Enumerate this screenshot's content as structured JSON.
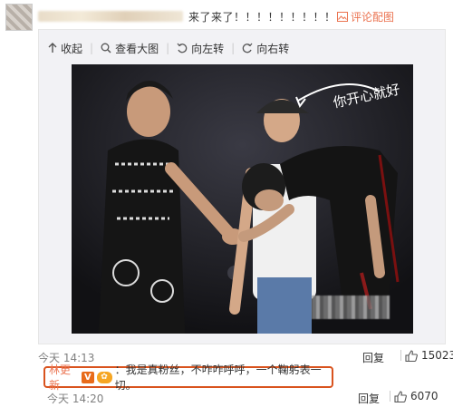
{
  "comment": {
    "text": "来了来了！！！！！！！！！",
    "config_label": "评论配图"
  },
  "toolbar": {
    "collapse_label": "收起",
    "view_large_label": "查看大图",
    "rotate_left_label": "向左转",
    "rotate_right_label": "向右转"
  },
  "photo": {
    "caption": "你开心就好"
  },
  "meta": {
    "time": "今天 14:13",
    "reply_label": "回复",
    "like_count": "15023"
  },
  "reply": {
    "user": "林更新",
    "text": "：我是真粉丝，不咋咋呼呼，一个鞠躬表一切。",
    "time": "今天 14:20",
    "reply_label": "回复",
    "like_count": "6070"
  },
  "colors": {
    "accent": "#eb7350",
    "highlight_border": "#d9531e"
  }
}
